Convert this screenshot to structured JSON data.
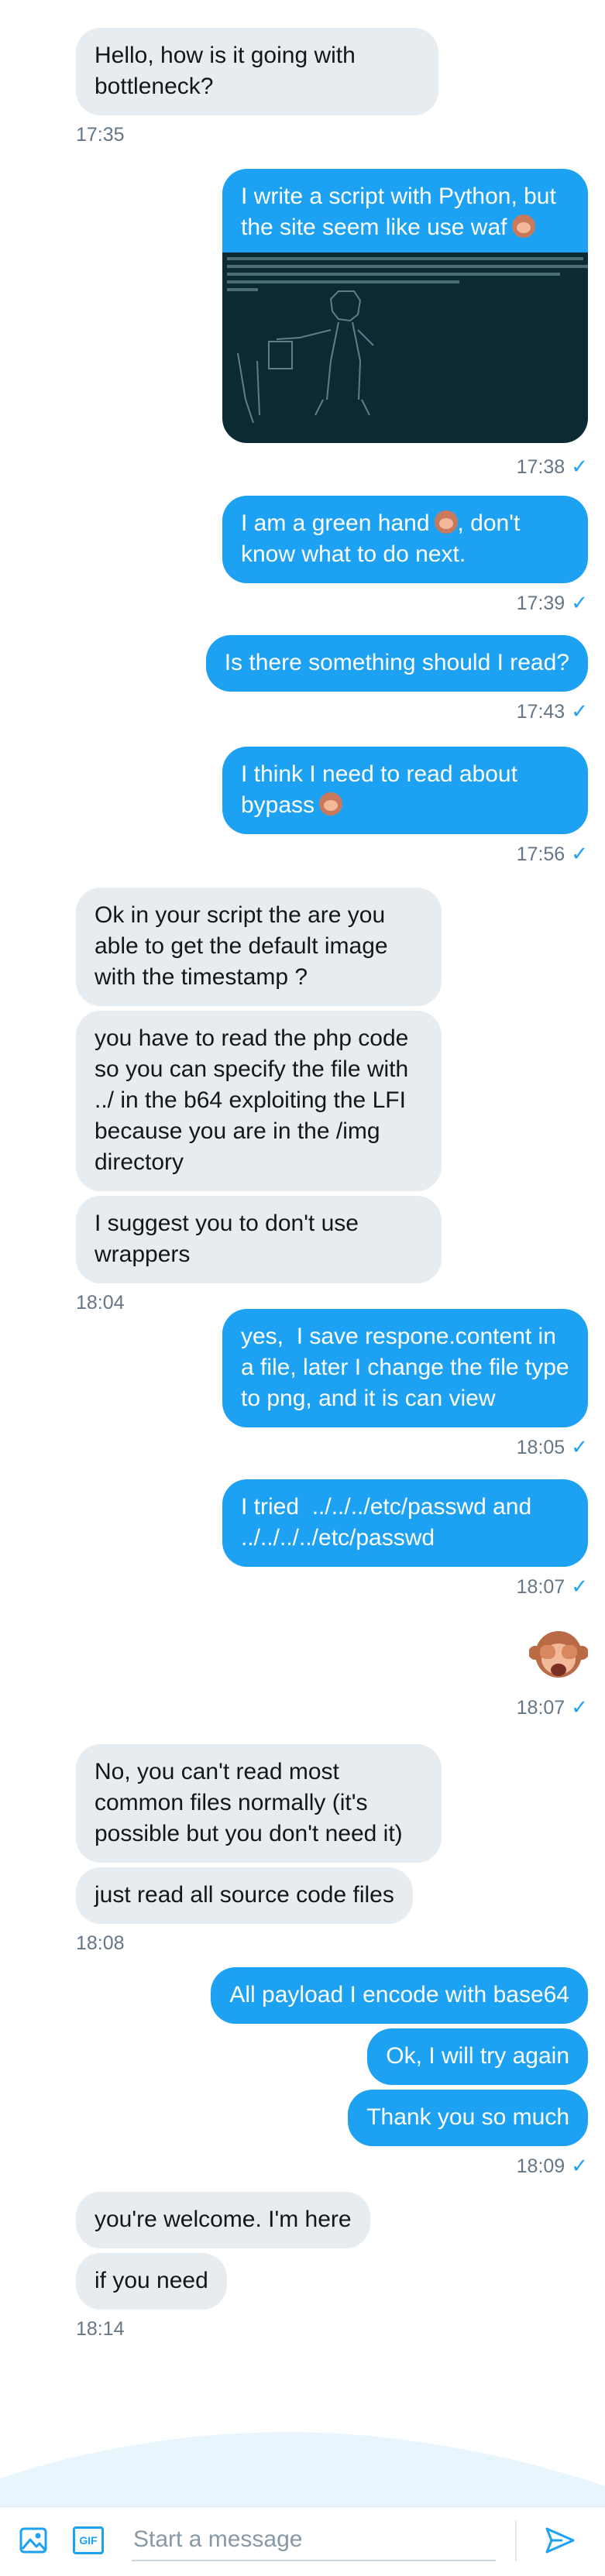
{
  "colors": {
    "accent": "#1da1f2",
    "incoming_bubble": "#e6ecf0",
    "time": "#657786"
  },
  "messages": [
    {
      "dir": "in",
      "lines": [
        "Hello, how is it going with bottleneck?"
      ],
      "time": "17:35"
    },
    {
      "dir": "out",
      "lines": [
        "I write a script with Python, but the site seem like use waf"
      ],
      "emoji": "monkey-face",
      "has_screenshot": true,
      "time": "17:38"
    },
    {
      "dir": "out",
      "lines": [
        "I am a green hand"
      ],
      "emoji_mid": "monkey-face",
      "tail": ", don't know what to do next.",
      "time": "17:39"
    },
    {
      "dir": "out",
      "lines": [
        "Is there something should I read?"
      ],
      "time": "17:43"
    },
    {
      "dir": "out",
      "lines": [
        "I think I need to read about bypass"
      ],
      "emoji": "monkey-face",
      "time": "17:56"
    },
    {
      "dir": "in",
      "lines": [
        "Ok in your script the are you able to get the default image with the timestamp ?",
        "you have to read the php code so you can specify the file with ../ in the b64 exploiting the LFI because you are in the /img directory",
        "I suggest you to don't use wrappers"
      ],
      "time": "18:04"
    },
    {
      "dir": "out",
      "lines": [
        "yes,  I save respone.content in a file, later I change the file type to png, and it is can view"
      ],
      "time": "18:05"
    },
    {
      "dir": "out",
      "lines": [
        "I tried  ../../../etc/passwd and ../../../../etc/passwd"
      ],
      "time": "18:07"
    },
    {
      "dir": "out",
      "big_emoji": "see-no-evil-monkey",
      "time": "18:07"
    },
    {
      "dir": "in",
      "lines": [
        "No, you can't read most common files normally (it's possible but you don't need it)",
        "just read all source code files"
      ],
      "time": "18:08"
    },
    {
      "dir": "out",
      "lines": [
        "All payload I encode with base64",
        "Ok, I will try again",
        "Thank you so much"
      ],
      "time": "18:09"
    },
    {
      "dir": "in",
      "lines": [
        "you're welcome. I'm here",
        "if you need"
      ],
      "time": "18:14"
    }
  ],
  "composer": {
    "placeholder": "Start a message",
    "media_icon": "image-icon",
    "gif_label": "GIF",
    "send_icon": "send-icon"
  }
}
